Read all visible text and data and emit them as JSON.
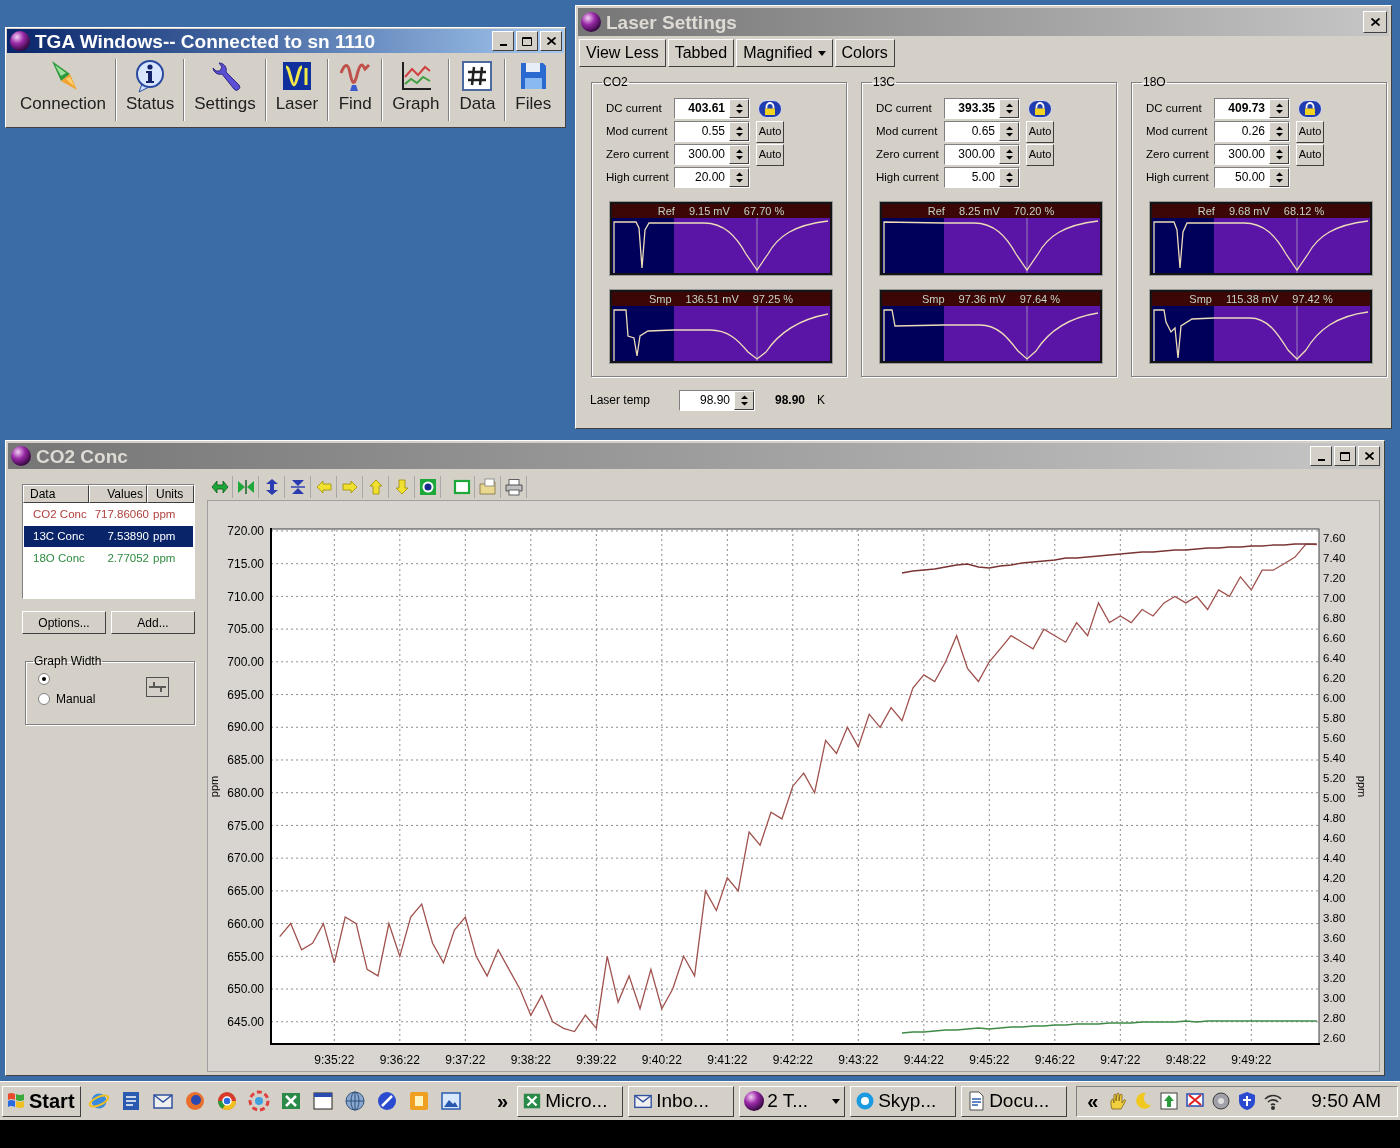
{
  "tga_window": {
    "title": "TGA Windows-- Connected to sn 1110",
    "active": true,
    "toolbar": [
      {
        "label": "Connection",
        "kind": "connection"
      },
      {
        "label": "Status",
        "kind": "status"
      },
      {
        "label": "Settings",
        "kind": "settings"
      },
      {
        "label": "Laser",
        "kind": "laser"
      },
      {
        "label": "Find",
        "kind": "find"
      },
      {
        "label": "Graph",
        "kind": "graph"
      },
      {
        "label": "Data",
        "kind": "data"
      },
      {
        "label": "Files",
        "kind": "files"
      }
    ]
  },
  "laser_settings": {
    "title": "Laser Settings",
    "active": false,
    "toolbar": [
      {
        "label": "View Less",
        "dropdown": false
      },
      {
        "label": "Tabbed",
        "dropdown": false
      },
      {
        "label": "Magnified",
        "dropdown": true
      },
      {
        "label": "Colors",
        "dropdown": false
      }
    ],
    "groups": [
      {
        "title": "CO2",
        "fields": [
          {
            "label": "DC current",
            "value": "403.61",
            "kind": "lock"
          },
          {
            "label": "Mod current",
            "value": "0.55",
            "kind": "auto",
            "button": "Auto"
          },
          {
            "label": "Zero current",
            "value": "300.00",
            "kind": "auto",
            "button": "Auto"
          },
          {
            "label": "High current",
            "value": "20.00",
            "kind": "plain"
          }
        ],
        "scopes": [
          {
            "kind": "ref",
            "label": "Ref",
            "voltage": "9.15 mV",
            "percent": "67.70 %"
          },
          {
            "kind": "smp",
            "label": "Smp",
            "voltage": "136.51 mV",
            "percent": "97.25 %"
          }
        ]
      },
      {
        "title": "13C",
        "fields": [
          {
            "label": "DC current",
            "value": "393.35",
            "kind": "lock"
          },
          {
            "label": "Mod current",
            "value": "0.65",
            "kind": "auto",
            "button": "Auto"
          },
          {
            "label": "Zero current",
            "value": "300.00",
            "kind": "auto",
            "button": "Auto"
          },
          {
            "label": "High current",
            "value": "5.00",
            "kind": "plain"
          }
        ],
        "scopes": [
          {
            "kind": "ref",
            "label": "Ref",
            "voltage": "8.25 mV",
            "percent": "70.20 %"
          },
          {
            "kind": "smp",
            "label": "Smp",
            "voltage": "97.36 mV",
            "percent": "97.64 %"
          }
        ]
      },
      {
        "title": "18O",
        "fields": [
          {
            "label": "DC current",
            "value": "409.73",
            "kind": "lock"
          },
          {
            "label": "Mod current",
            "value": "0.26",
            "kind": "auto",
            "button": "Auto"
          },
          {
            "label": "Zero current",
            "value": "300.00",
            "kind": "auto",
            "button": "Auto"
          },
          {
            "label": "High current",
            "value": "50.00",
            "kind": "plain"
          }
        ],
        "scopes": [
          {
            "kind": "ref",
            "label": "Ref",
            "voltage": "9.68 mV",
            "percent": "68.12 %"
          },
          {
            "kind": "smp",
            "label": "Smp",
            "voltage": "115.38 mV",
            "percent": "97.42 %"
          }
        ]
      }
    ],
    "laser_temp": {
      "label": "Laser temp",
      "value": "98.90",
      "reading": "98.90",
      "unit": "K"
    }
  },
  "conc_window": {
    "title": "CO2 Conc",
    "active": false,
    "list": {
      "columns": [
        "Data",
        "Values",
        "Units"
      ],
      "rows": [
        {
          "name": "CO2 Conc",
          "value": "717.86060",
          "unit": "ppm",
          "color": "#b0403c",
          "selected": false
        },
        {
          "name": "13C Conc",
          "value": "7.53890",
          "unit": "ppm",
          "selected": true
        },
        {
          "name": "18O Conc",
          "value": "2.77052",
          "unit": "ppm",
          "color": "#2e8a3e",
          "selected": false
        }
      ]
    },
    "buttons": [
      "Options...",
      "Add..."
    ],
    "graph_width": {
      "title": "Graph Width",
      "options": [
        {
          "selected": true
        },
        {
          "label": "Manual",
          "selected": false
        }
      ]
    },
    "chart": {
      "chart_data": {
        "type": "line",
        "grid": true,
        "ylabel": "ppm",
        "y2label": "ppm",
        "categories": [
          null,
          null,
          null,
          null,
          null,
          "9:35:22",
          null,
          null,
          null,
          null,
          null,
          "9:36:22",
          null,
          null,
          null,
          null,
          null,
          "9:37:22",
          null,
          null,
          null,
          null,
          null,
          "9:38:22",
          null,
          null,
          null,
          null,
          null,
          "9:39:22",
          null,
          null,
          null,
          null,
          null,
          "9:40:22",
          null,
          null,
          null,
          null,
          null,
          "9:41:22",
          null,
          null,
          null,
          null,
          null,
          "9:42:22",
          null,
          null,
          null,
          null,
          null,
          "9:43:22",
          null,
          null,
          null,
          null,
          null,
          "9:44:22",
          null,
          null,
          null,
          null,
          null,
          "9:45:22",
          null,
          null,
          null,
          null,
          null,
          "9:46:22",
          null,
          null,
          null,
          null,
          null,
          "9:47:22",
          null,
          null,
          null,
          null,
          null,
          "9:48:22",
          null,
          null,
          null,
          null,
          null,
          "9:49:22",
          null,
          null,
          null,
          null,
          null,
          null
        ],
        "ylim": [
          641.6,
          720.3
        ],
        "yticks": [
          {
            "value": 645,
            "label": "645.00"
          },
          {
            "value": 650,
            "label": "650.00"
          },
          {
            "value": 655,
            "label": "655.00"
          },
          {
            "value": 660,
            "label": "660.00"
          },
          {
            "value": 665,
            "label": "665.00"
          },
          {
            "value": 670,
            "label": "670.00"
          },
          {
            "value": 675,
            "label": "675.00"
          },
          {
            "value": 680,
            "label": "680.00"
          },
          {
            "value": 685,
            "label": "685.00"
          },
          {
            "value": 690,
            "label": "690.00"
          },
          {
            "value": 695,
            "label": "695.00"
          },
          {
            "value": 700,
            "label": "700.00"
          },
          {
            "value": 705,
            "label": "705.00"
          },
          {
            "value": 710,
            "label": "710.00"
          },
          {
            "value": 715,
            "label": "715.00"
          },
          {
            "value": 720,
            "label": "720.00"
          }
        ],
        "y2lim": [
          2.54,
          7.69
        ],
        "y2ticks": [
          {
            "value": 2.6,
            "label": "2.60"
          },
          {
            "value": 2.8,
            "label": "2.80"
          },
          {
            "value": 3.0,
            "label": "3.00"
          },
          {
            "value": 3.2,
            "label": "3.20"
          },
          {
            "value": 3.4,
            "label": "3.40"
          },
          {
            "value": 3.6,
            "label": "3.60"
          },
          {
            "value": 3.8,
            "label": "3.80"
          },
          {
            "value": 4.0,
            "label": "4.00"
          },
          {
            "value": 4.2,
            "label": "4.20"
          },
          {
            "value": 4.4,
            "label": "4.40"
          },
          {
            "value": 4.6,
            "label": "4.60"
          },
          {
            "value": 4.8,
            "label": "4.80"
          },
          {
            "value": 5.0,
            "label": "5.00"
          },
          {
            "value": 5.2,
            "label": "5.20"
          },
          {
            "value": 5.4,
            "label": "5.40"
          },
          {
            "value": 5.6,
            "label": "5.60"
          },
          {
            "value": 5.8,
            "label": "5.80"
          },
          {
            "value": 6.0,
            "label": "6.00"
          },
          {
            "value": 6.2,
            "label": "6.20"
          },
          {
            "value": 6.4,
            "label": "6.40"
          },
          {
            "value": 6.6,
            "label": "6.60"
          },
          {
            "value": 6.8,
            "label": "6.80"
          },
          {
            "value": 7.0,
            "label": "7.00"
          },
          {
            "value": 7.2,
            "label": "7.20"
          },
          {
            "value": 7.4,
            "label": "7.40"
          },
          {
            "value": 7.6,
            "label": "7.60"
          }
        ],
        "series": [
          {
            "color": "#a0524e",
            "values": [
              658,
              660,
              656,
              657,
              660,
              654,
              661,
              660,
              653,
              652,
              660,
              655,
              661,
              663,
              657,
              654,
              659,
              661,
              655,
              652,
              656,
              653,
              650,
              646,
              649,
              645,
              644,
              643.5,
              646,
              644,
              655,
              648,
              652,
              647,
              653,
              647,
              650,
              655,
              652,
              665,
              662,
              667,
              665,
              674,
              672,
              677,
              676,
              681,
              683,
              680,
              688,
              686,
              690,
              687,
              692,
              690,
              693,
              691,
              696,
              698,
              697,
              700,
              704,
              699,
              697,
              700,
              702,
              704,
              703,
              702,
              705,
              704,
              703,
              706,
              704,
              709,
              706,
              707,
              706,
              708,
              707,
              709,
              710,
              709,
              710,
              708,
              711,
              710,
              713,
              711,
              714,
              714,
              715,
              716,
              718,
              717.9
            ]
          },
          {
            "color": "#7a3434",
            "axis": "y2",
            "values": [
              null,
              null,
              null,
              null,
              null,
              null,
              null,
              null,
              null,
              null,
              null,
              null,
              null,
              null,
              null,
              null,
              null,
              null,
              null,
              null,
              null,
              null,
              null,
              null,
              null,
              null,
              null,
              null,
              null,
              null,
              null,
              null,
              null,
              null,
              null,
              null,
              null,
              null,
              null,
              null,
              null,
              null,
              null,
              null,
              null,
              null,
              null,
              null,
              null,
              null,
              null,
              null,
              null,
              null,
              null,
              null,
              null,
              7.25,
              7.27,
              7.28,
              7.29,
              7.31,
              7.33,
              7.34,
              7.31,
              7.3,
              7.32,
              7.33,
              7.35,
              7.36,
              7.37,
              7.38,
              7.4,
              7.4,
              7.41,
              7.42,
              7.43,
              7.44,
              7.45,
              7.46,
              7.46,
              7.47,
              7.48,
              7.48,
              7.49,
              7.5,
              7.5,
              7.51,
              7.51,
              7.52,
              7.52,
              7.53,
              7.53,
              7.54,
              7.54,
              7.54
            ]
          },
          {
            "color": "#3e8a46",
            "axis": "y2",
            "values": [
              null,
              null,
              null,
              null,
              null,
              null,
              null,
              null,
              null,
              null,
              null,
              null,
              null,
              null,
              null,
              null,
              null,
              null,
              null,
              null,
              null,
              null,
              null,
              null,
              null,
              null,
              null,
              null,
              null,
              null,
              null,
              null,
              null,
              null,
              null,
              null,
              null,
              null,
              null,
              null,
              null,
              null,
              null,
              null,
              null,
              null,
              null,
              null,
              null,
              null,
              null,
              null,
              null,
              null,
              null,
              null,
              null,
              2.65,
              2.66,
              2.66,
              2.67,
              2.68,
              2.68,
              2.69,
              2.7,
              2.69,
              2.7,
              2.71,
              2.71,
              2.72,
              2.72,
              2.73,
              2.73,
              2.74,
              2.74,
              2.74,
              2.75,
              2.75,
              2.75,
              2.76,
              2.76,
              2.76,
              2.76,
              2.77,
              2.76,
              2.77,
              2.77,
              2.77,
              2.77,
              2.77,
              2.77,
              2.77,
              2.77,
              2.77,
              2.77,
              2.77
            ]
          }
        ]
      }
    }
  },
  "taskbar": {
    "start": "Start",
    "more": "»",
    "tasks": [
      {
        "label": "Micro...",
        "kind": "spreadsheet",
        "grouped": false
      },
      {
        "label": "Inbo...",
        "kind": "mail",
        "grouped": false
      },
      {
        "label": "2 T...",
        "kind": "app",
        "grouped": true
      },
      {
        "label": "Skyp...",
        "kind": "chat",
        "grouped": false
      },
      {
        "label": "Docu...",
        "kind": "document",
        "grouped": false
      }
    ],
    "tray_expand": "«",
    "clock": "9:50 AM"
  }
}
